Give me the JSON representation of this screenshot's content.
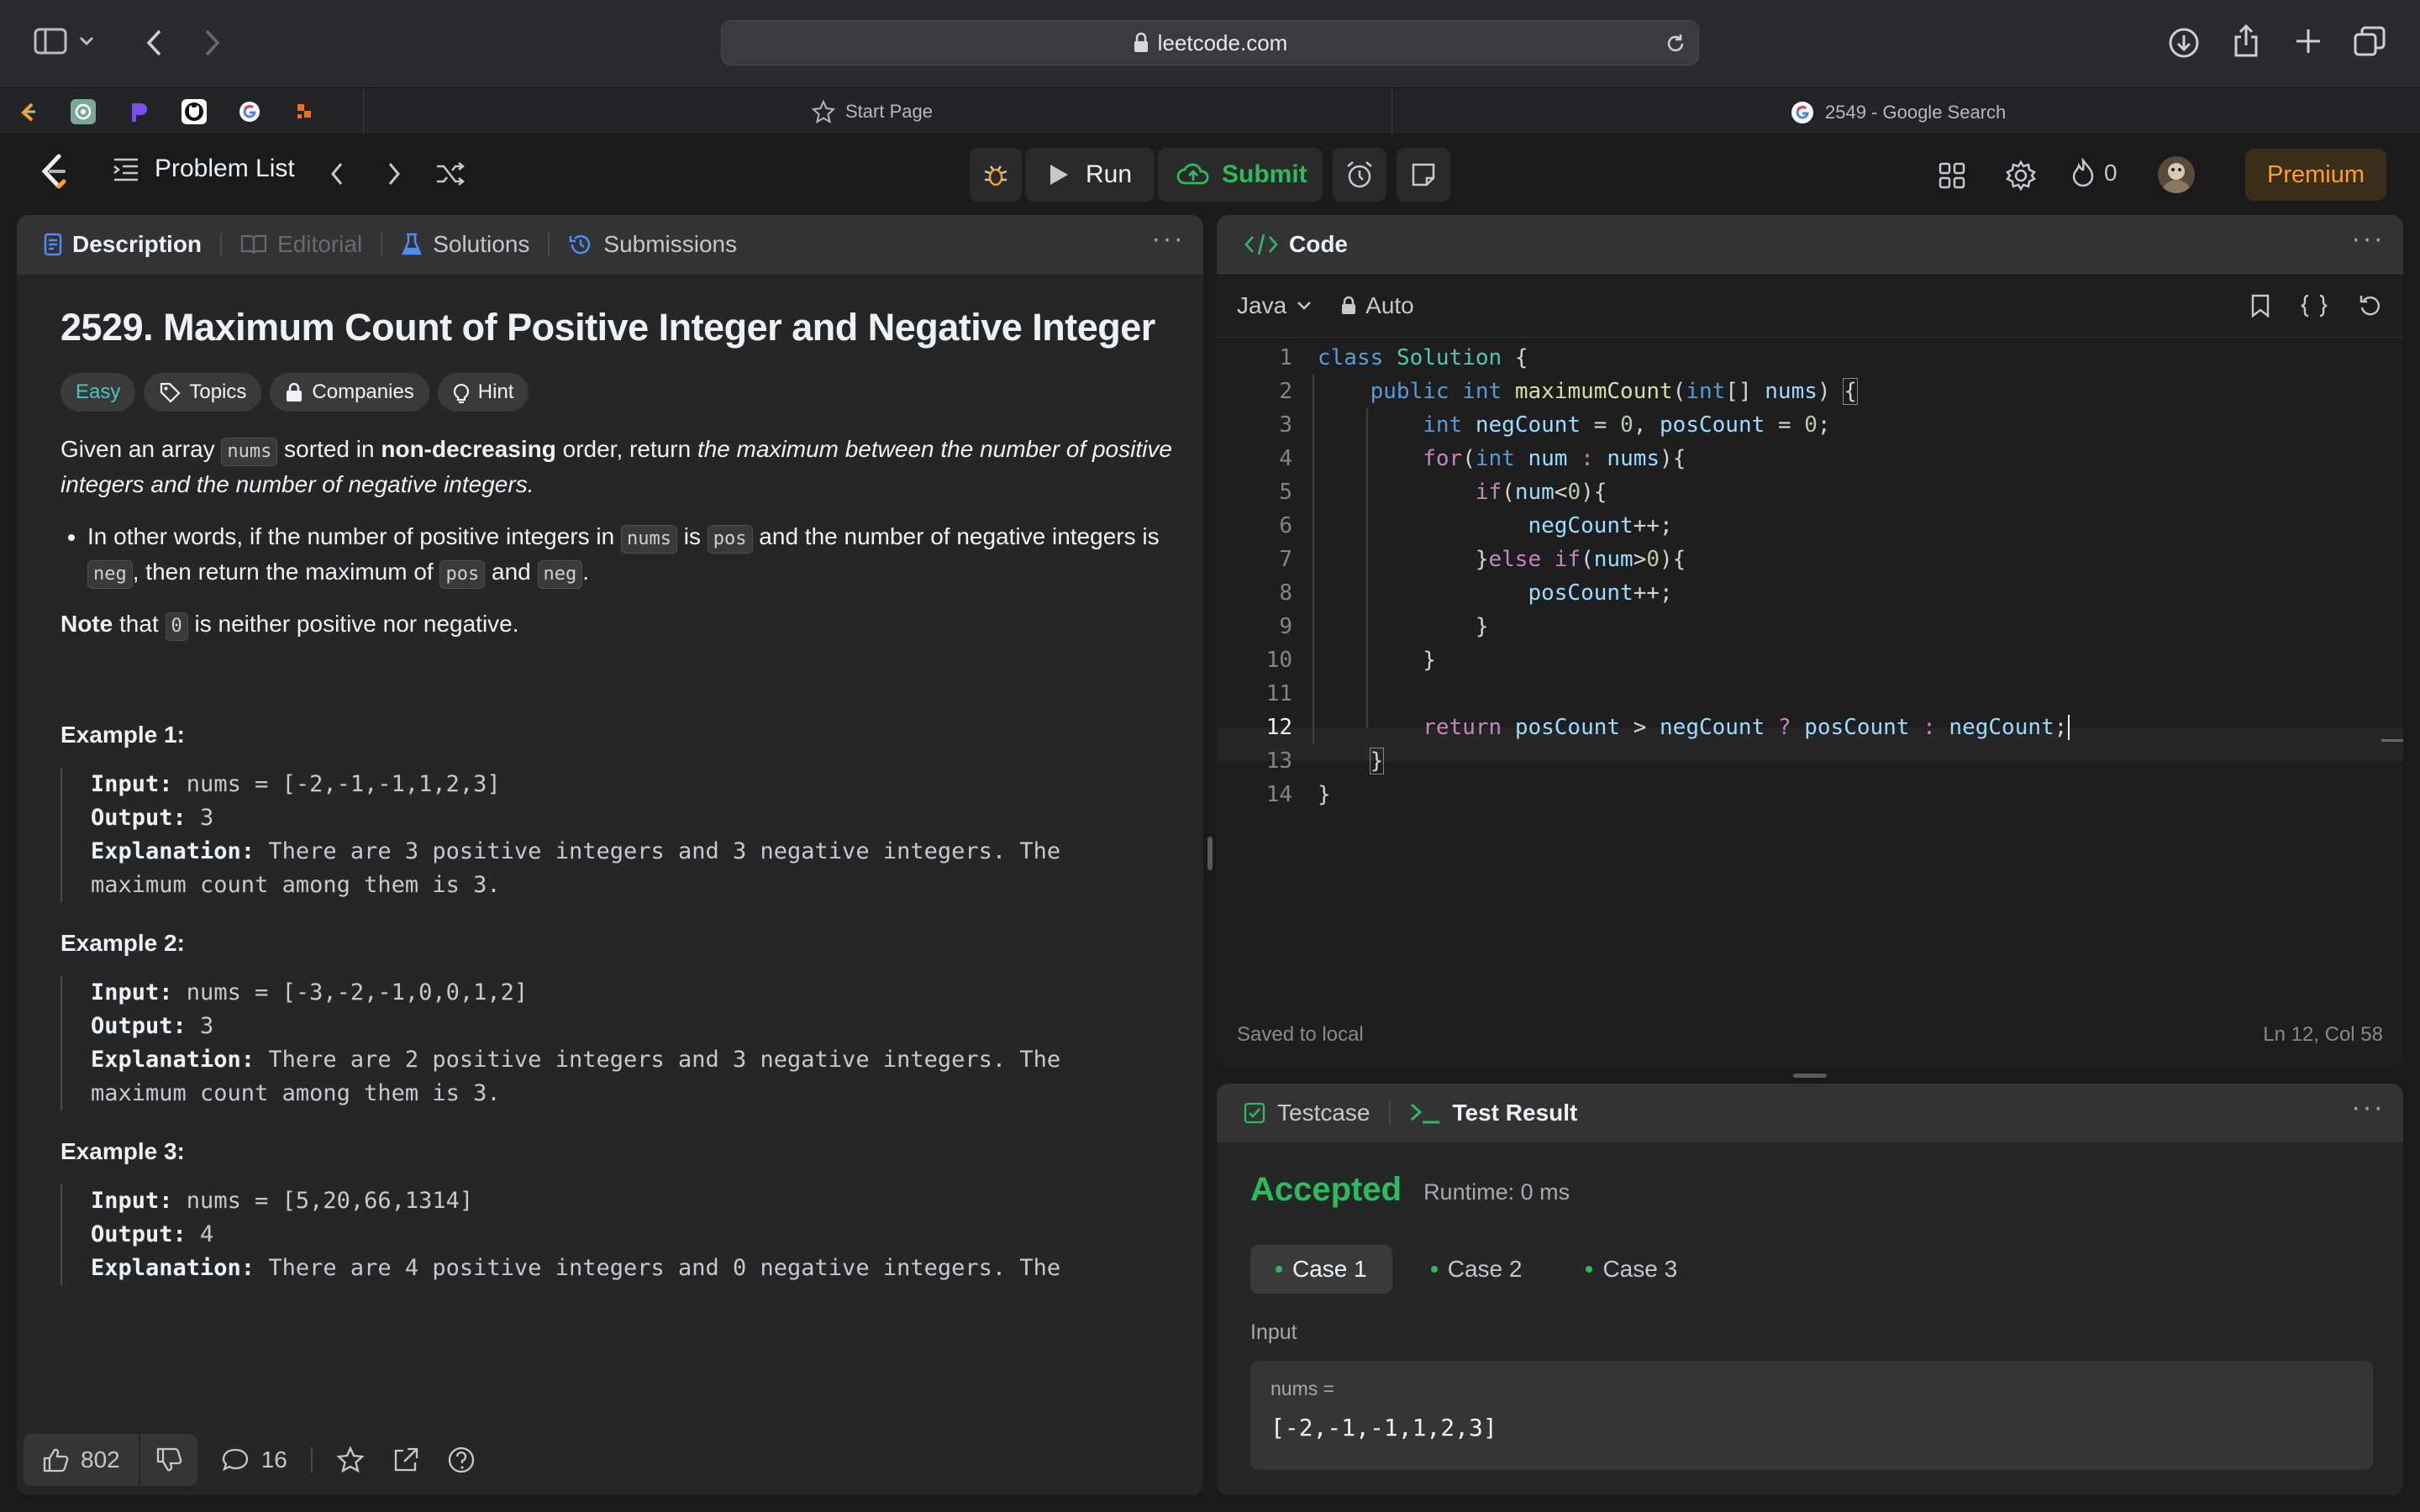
{
  "browser": {
    "url": "leetcode.com",
    "tabs": [
      {
        "label": "Start Page"
      },
      {
        "label": "2549 - Google Search"
      }
    ],
    "pinned_tabs": [
      "leetcode-icon",
      "chatgpt-icon",
      "proton-icon",
      "github-icon",
      "google-icon",
      "orange-icon"
    ]
  },
  "nav": {
    "problem_list": "Problem List",
    "run": "Run",
    "submit": "Submit",
    "streak": "0",
    "premium": "Premium"
  },
  "desc_panel": {
    "tabs": [
      "Description",
      "Editorial",
      "Solutions",
      "Submissions"
    ],
    "title": "2529. Maximum Count of Positive Integer and Negative Integer",
    "chips": [
      "Easy",
      "Topics",
      "Companies",
      "Hint"
    ],
    "p1": {
      "a": "Given an array ",
      "code1": "nums",
      "b": " sorted in ",
      "bold": "non-decreasing",
      "c": " order, return ",
      "italic": "the maximum between the number of positive integers and the number of negative integers."
    },
    "bullet": {
      "a": "In other words, if the number of positive integers in ",
      "code1": "nums",
      "b": " is ",
      "code2": "pos",
      "c": " and the number of negative integers is ",
      "code3": "neg",
      "d": ", then return the maximum of ",
      "code4": "pos",
      "e": " and ",
      "code5": "neg",
      "f": "."
    },
    "note": {
      "bold": "Note",
      "a": " that ",
      "code": "0",
      "b": " is neither positive nor negative."
    },
    "examples": [
      {
        "heading": "Example 1:",
        "input_label": "Input:",
        "input": " nums = [-2,-1,-1,1,2,3]",
        "output_label": "Output:",
        "output": " 3",
        "expl_label": "Explanation:",
        "expl1": " There are 3 positive integers and 3 negative integers. The",
        "expl2": "maximum count among them is 3."
      },
      {
        "heading": "Example 2:",
        "input_label": "Input:",
        "input": " nums = [-3,-2,-1,0,0,1,2]",
        "output_label": "Output:",
        "output": " 3",
        "expl_label": "Explanation:",
        "expl1": " There are 2 positive integers and 3 negative integers. The",
        "expl2": "maximum count among them is 3."
      },
      {
        "heading": "Example 3:",
        "input_label": "Input:",
        "input": " nums = [5,20,66,1314]",
        "output_label": "Output:",
        "output": " 4",
        "expl_label": "Explanation:",
        "expl1": " There are 4 positive integers and 0 negative integers. The"
      }
    ],
    "footer": {
      "likes": "802",
      "comments": "16"
    }
  },
  "code_panel": {
    "title": "Code",
    "language": "Java",
    "mode": "Auto",
    "status_left": "Saved to local",
    "status_right": "Ln 12, Col 58",
    "line_numbers": [
      "1",
      "2",
      "3",
      "4",
      "5",
      "6",
      "7",
      "8",
      "9",
      "10",
      "11",
      "12",
      "13",
      "14"
    ]
  },
  "result_panel": {
    "tabs": [
      "Testcase",
      "Test Result"
    ],
    "verdict": "Accepted",
    "runtime": "Runtime: 0 ms",
    "cases": [
      "Case 1",
      "Case 2",
      "Case 3"
    ],
    "input_label": "Input",
    "var_name": "nums =",
    "var_value": "[-2,-1,-1,1,2,3]"
  },
  "colors": {
    "accent_green": "#2cbb5d",
    "easy": "#46c6c2",
    "premium": "#ffa116",
    "accepted": "#2cbb5d"
  }
}
